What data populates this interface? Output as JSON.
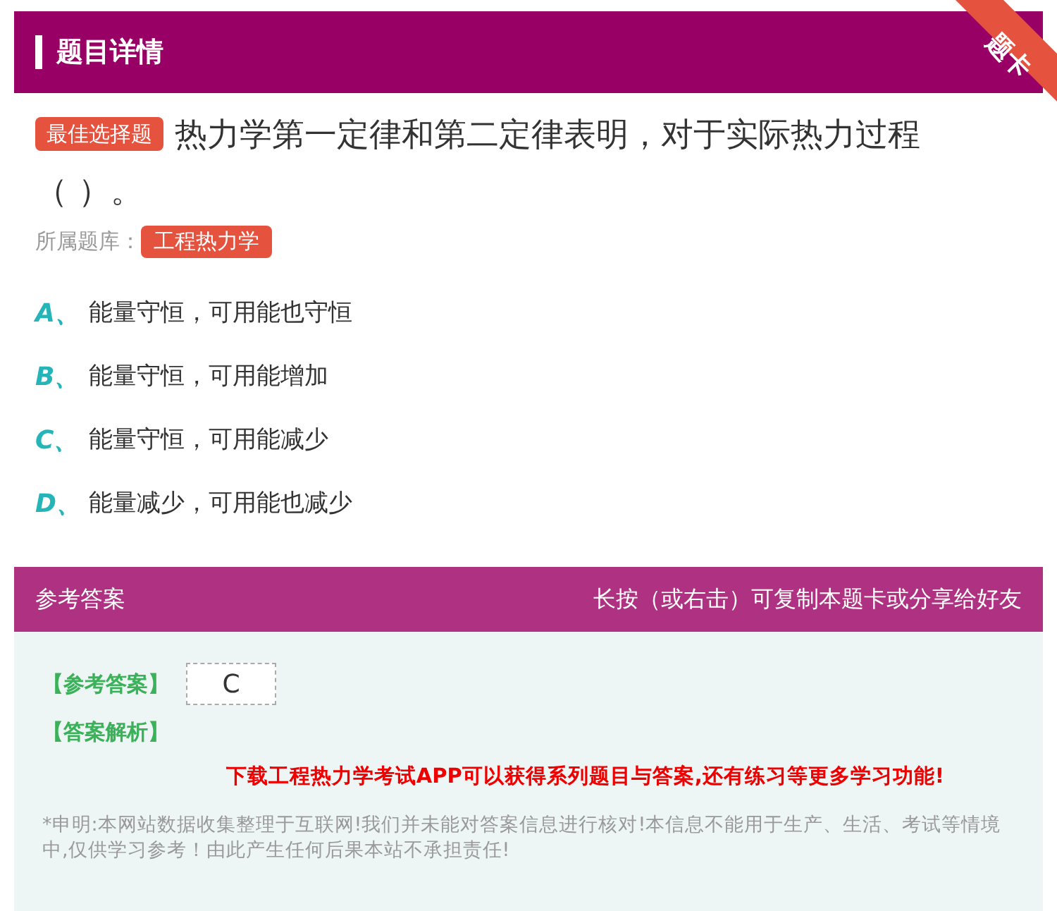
{
  "header": {
    "title": "题目详情",
    "ribbon": "题卡"
  },
  "question": {
    "type_badge": "最佳选择题",
    "text": "热力学第一定律和第二定律表明，对于实际热力过程（ ）。",
    "bank_label": "所属题库：",
    "bank": "工程热力学"
  },
  "options": [
    {
      "letter": "A、",
      "text": "能量守恒，可用能也守恒"
    },
    {
      "letter": "B、",
      "text": "能量守恒，可用能增加"
    },
    {
      "letter": "C、",
      "text": "能量守恒，可用能减少"
    },
    {
      "letter": "D、",
      "text": "能量减少，可用能也减少"
    }
  ],
  "answer": {
    "title": "参考答案",
    "hint": "长按（或右击）可复制本题卡或分享给好友",
    "answer_label": "【参考答案】",
    "answer_value": "C",
    "analysis_label": "【答案解析】",
    "promo": "下载工程热力学考试APP可以获得系列题目与答案,还有练习等更多学习功能!",
    "disclaimer": "*申明:本网站数据收集整理于互联网!我们并未能对答案信息进行核对!本信息不能用于生产、生活、考试等情境中,仅供学习参考！由此产生任何后果本站不承担责任!"
  }
}
